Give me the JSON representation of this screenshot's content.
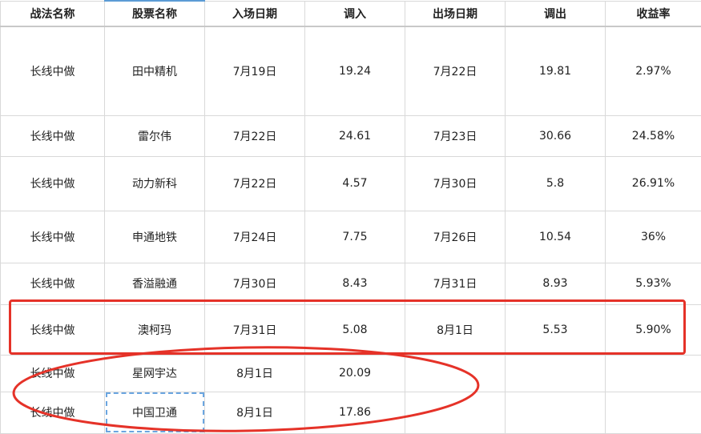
{
  "headers": {
    "strategy": "战法名称",
    "stock": "股票名称",
    "entry_date": "入场日期",
    "buy": "调入",
    "exit_date": "出场日期",
    "sell": "调出",
    "yield": "收益率"
  },
  "rows": [
    {
      "strategy": "长线中做",
      "stock": "田中精机",
      "entry_date": "7月19日",
      "buy": "19.24",
      "exit_date": "7月22日",
      "sell": "19.81",
      "yield": "2.97%"
    },
    {
      "strategy": "长线中做",
      "stock": "雷尔伟",
      "entry_date": "7月22日",
      "buy": "24.61",
      "exit_date": "7月23日",
      "sell": "30.66",
      "yield": "24.58%"
    },
    {
      "strategy": "长线中做",
      "stock": "动力新科",
      "entry_date": "7月22日",
      "buy": "4.57",
      "exit_date": "7月30日",
      "sell": "5.8",
      "yield": "26.91%"
    },
    {
      "strategy": "长线中做",
      "stock": "申通地铁",
      "entry_date": "7月24日",
      "buy": "7.75",
      "exit_date": "7月26日",
      "sell": "10.54",
      "yield": "36%"
    },
    {
      "strategy": "长线中做",
      "stock": "香溢融通",
      "entry_date": "7月30日",
      "buy": "8.43",
      "exit_date": "7月31日",
      "sell": "8.93",
      "yield": "5.93%"
    },
    {
      "strategy": "长线中做",
      "stock": "澳柯玛",
      "entry_date": "7月31日",
      "buy": "5.08",
      "exit_date": "8月1日",
      "sell": "5.53",
      "yield": "5.90%"
    },
    {
      "strategy": "长线中做",
      "stock": "星网宇达",
      "entry_date": "8月1日",
      "buy": "20.09",
      "exit_date": "",
      "sell": "",
      "yield": ""
    },
    {
      "strategy": "长线中做",
      "stock": "中国卫通",
      "entry_date": "8月1日",
      "buy": "17.86",
      "exit_date": "",
      "sell": "",
      "yield": ""
    }
  ],
  "annotation_colors": {
    "highlight": "#e53228",
    "selection": "#5b9bd5"
  }
}
